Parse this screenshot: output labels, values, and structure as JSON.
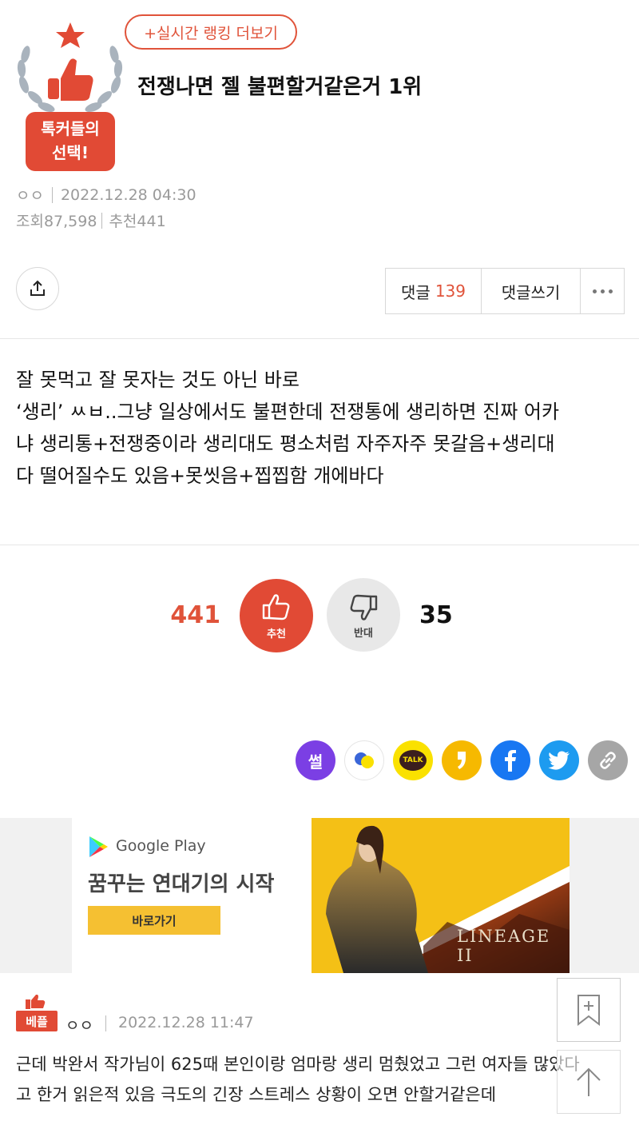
{
  "header": {
    "badge_text_line1": "톡커들의",
    "badge_text_line2": "선택!",
    "ranking_button": "+실시간 랭킹 더보기",
    "title": "전쟁나면 젤 불편할거같은거 1위",
    "author": "ㅇㅇ",
    "datetime": "2022.12.28 04:30",
    "views": "조회87,598",
    "recommends": "추천441"
  },
  "toolbar": {
    "comments_label": "댓글",
    "comments_count": "139",
    "write_comment": "댓글쓰기"
  },
  "post": {
    "lines": [
      "잘 못먹고 잘 못자는 것도 아닌 바로",
      "‘생리’ ㅆㅂ..그냥 일상에서도 불편한데 전쟁통에 생리하면 진짜 어카",
      "냐 생리통+전쟁중이라 생리대도 평소처럼 자주자주 못갈음+생리대",
      "다 떨어질수도 있음+못씻음+찝찝함 개에바다"
    ]
  },
  "votes": {
    "up_count": "441",
    "up_label": "추천",
    "down_label": "반대",
    "down_count": "35"
  },
  "share": {
    "ssul": "썰",
    "talk": "TALK",
    "colors": {
      "ssul": "#7b3fe4",
      "kakaotalk": "#fae100",
      "kakaostory": "#f6b900",
      "facebook": "#1877f2",
      "twitter": "#1d9bf0",
      "link": "#a6a6a6"
    }
  },
  "ad": {
    "store": "Google Play",
    "headline": "꿈꾸는 연대기의 시작",
    "cta": "바로가기",
    "game": "LINEAGE II"
  },
  "comment": {
    "badge": "베플",
    "author": "ㅇㅇ",
    "datetime": "2022.12.28 11:47",
    "lines": [
      "근데 박완서 작가님이 625때 본인이랑 엄마랑 생리 멈췄었고 그런 여자들 많았다",
      "고 한거 읽은적 있음 극도의 긴장 스트레스 상황이 오면 안할거같은데"
    ]
  },
  "accent_color": "#e0533a"
}
